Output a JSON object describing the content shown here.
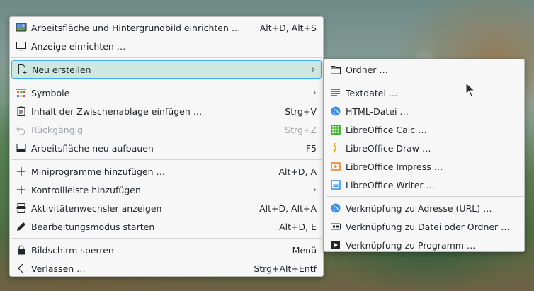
{
  "main_menu": {
    "items": [
      {
        "label": "Arbeitsfläche und Hintergrundbild einrichten …",
        "shortcut": "Alt+D, Alt+S",
        "icon": "desktop-wallpaper-icon"
      },
      {
        "label": "Anzeige einrichten …",
        "shortcut": "",
        "icon": "monitor-icon"
      },
      {
        "label": "Neu erstellen",
        "shortcut": "",
        "icon": "new-document-icon",
        "submenu": true,
        "highlighted": true
      },
      {
        "label": "Symbole",
        "shortcut": "",
        "icon": "icon-view-icon",
        "submenu": true
      },
      {
        "label": "Inhalt der Zwischenablage einfügen …",
        "shortcut": "Strg+V",
        "icon": "clipboard-icon"
      },
      {
        "label": "Rückgängig",
        "shortcut": "Strg+Z",
        "icon": "undo-icon",
        "disabled": true
      },
      {
        "label": "Arbeitsfläche neu aufbauen",
        "shortcut": "F5",
        "icon": "refresh-desktop-icon"
      },
      {
        "label": "Miniprogramme hinzufügen …",
        "shortcut": "Alt+D, A",
        "icon": "plus-icon"
      },
      {
        "label": "Kontrollleiste hinzufügen",
        "shortcut": "",
        "icon": "plus-icon",
        "submenu": true
      },
      {
        "label": "Aktivitätenwechsler anzeigen",
        "shortcut": "Alt+D, Alt+A",
        "icon": "activities-icon"
      },
      {
        "label": "Bearbeitungsmodus starten",
        "shortcut": "Alt+D, E",
        "icon": "edit-pencil-icon"
      },
      {
        "label": "Bildschirm sperren",
        "shortcut": "Menü",
        "icon": "lock-icon"
      },
      {
        "label": "Verlassen …",
        "shortcut": "Strg+Alt+Entf",
        "icon": "chevron-left-icon"
      }
    ]
  },
  "sub_menu": {
    "items": [
      {
        "label": "Ordner …",
        "icon": "folder-icon"
      },
      {
        "label": "Textdatei …",
        "icon": "text-file-icon"
      },
      {
        "label": "HTML-Datei …",
        "icon": "globe-icon"
      },
      {
        "label": "LibreOffice Calc …",
        "icon": "libreoffice-calc-icon"
      },
      {
        "label": "LibreOffice Draw …",
        "icon": "libreoffice-draw-icon"
      },
      {
        "label": "LibreOffice Impress …",
        "icon": "libreoffice-impress-icon"
      },
      {
        "label": "LibreOffice Writer …",
        "icon": "libreoffice-writer-icon"
      },
      {
        "label": "Verknüpfung zu Adresse (URL) …",
        "icon": "globe-icon"
      },
      {
        "label": "Verknüpfung zu Datei oder Ordner …",
        "icon": "link-file-icon"
      },
      {
        "label": "Verknüpfung zu Programm …",
        "icon": "link-program-icon"
      }
    ]
  },
  "submenu_arrow": "›",
  "colors": {
    "highlight_bg": "#cde8e3",
    "highlight_border": "#3daee9",
    "menu_bg": "#f7f7f8",
    "disabled_text": "#a0a3a6"
  }
}
